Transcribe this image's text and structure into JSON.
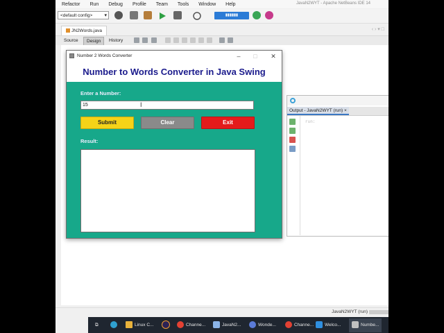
{
  "ide": {
    "title": "JavaN2WYT - Apache NetBeans IDE 14",
    "menu": [
      "Refactor",
      "Run",
      "Debug",
      "Profile",
      "Team",
      "Tools",
      "Window",
      "Help"
    ],
    "config_select": "<default config>",
    "file_tab": "JN2Words.java",
    "subtabs": [
      "Source",
      "Design",
      "History"
    ],
    "status_text": "JavaN2WYT (run)"
  },
  "output": {
    "tab_label": "Output - JavaN2WYT (run)"
  },
  "app": {
    "window_title": "Number 2 Words Converter",
    "heading": "Number to Words Converter in Java Swing",
    "input_label": "Enter a Number:",
    "input_value": "15",
    "submit_label": "Submit",
    "clear_label": "Clear",
    "exit_label": "Exit",
    "result_label": "Result:",
    "result_value": "",
    "colors": {
      "panel": "#17a88a",
      "heading": "#1a1a8c",
      "submit": "#f5d318",
      "clear": "#8a8a8a",
      "exit": "#e41b1b"
    }
  },
  "taskbar": {
    "items": [
      {
        "label": "Linux C...",
        "icon": "folder-icon",
        "color": "#e9b23b"
      },
      {
        "label": "Channe...",
        "icon": "chrome-icon",
        "color": "#e34133"
      },
      {
        "label": "JavaN2...",
        "icon": "netbeans-icon",
        "color": "#8bb4e8"
      },
      {
        "label": "Wonde...",
        "icon": "wondershare-icon",
        "color": "#5b7bd8"
      },
      {
        "label": "Channe...",
        "icon": "chrome-icon",
        "color": "#e34133"
      },
      {
        "label": "Welco...",
        "icon": "vscode-icon",
        "color": "#2f8fe0"
      },
      {
        "label": "Numbe...",
        "icon": "java-icon",
        "color": "#c0c0c0"
      }
    ]
  }
}
